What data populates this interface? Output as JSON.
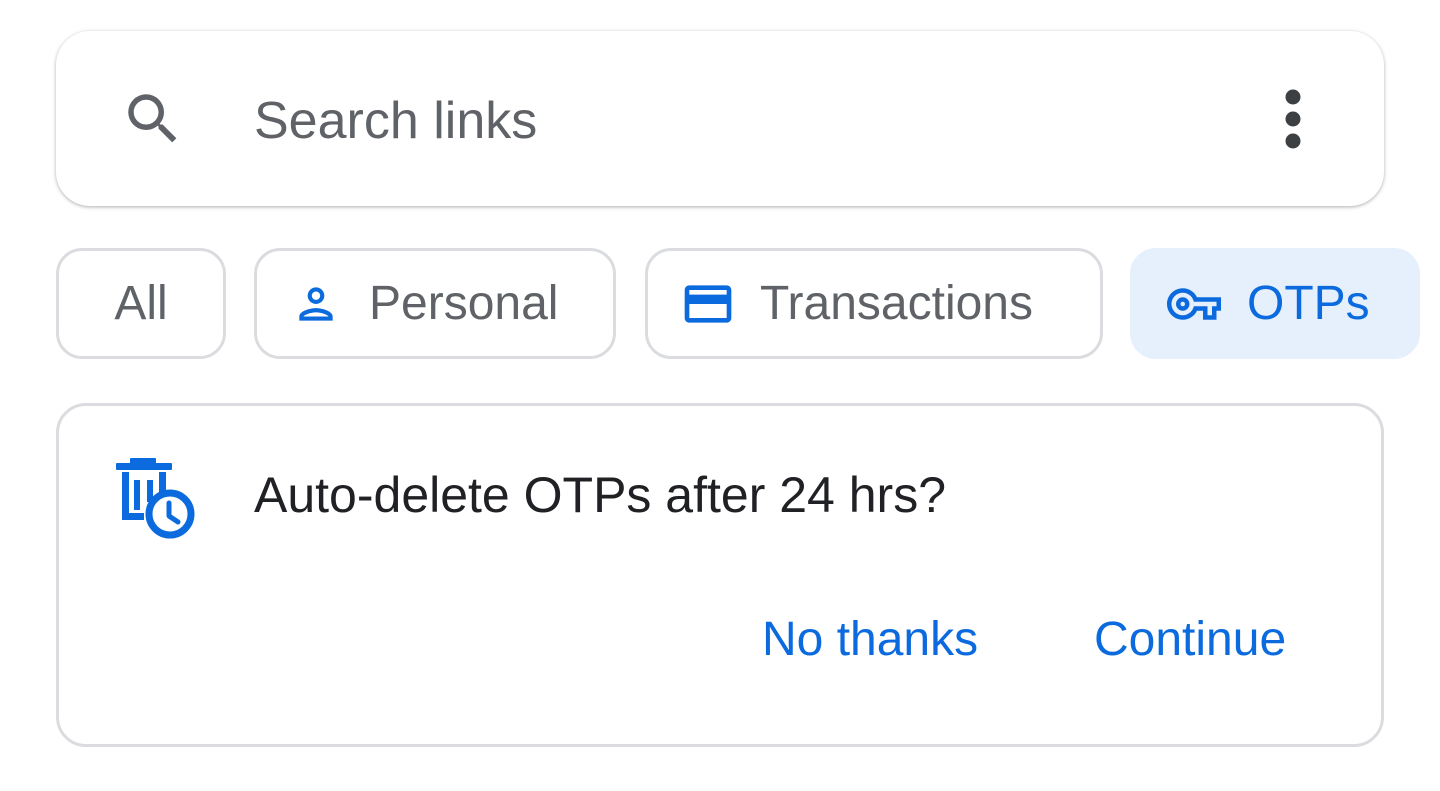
{
  "search": {
    "placeholder": "Search links",
    "search_icon": "search-icon",
    "menu_icon": "more-vert-icon"
  },
  "filters": [
    {
      "label": "All",
      "icon": null,
      "selected": false
    },
    {
      "label": "Personal",
      "icon": "person-icon",
      "selected": false
    },
    {
      "label": "Transactions",
      "icon": "credit-card-icon",
      "selected": false
    },
    {
      "label": "OTPs",
      "icon": "key-icon",
      "selected": true
    }
  ],
  "card": {
    "icon": "delete-clock-icon",
    "title": "Auto-delete OTPs after 24 hrs?",
    "dismiss_label": "No thanks",
    "confirm_label": "Continue"
  },
  "colors": {
    "accent": "#0b6bde",
    "selected_chip_bg": "#e6f0fc",
    "text_secondary": "#5f6368",
    "text_primary": "#202124",
    "border": "#dadce0"
  }
}
